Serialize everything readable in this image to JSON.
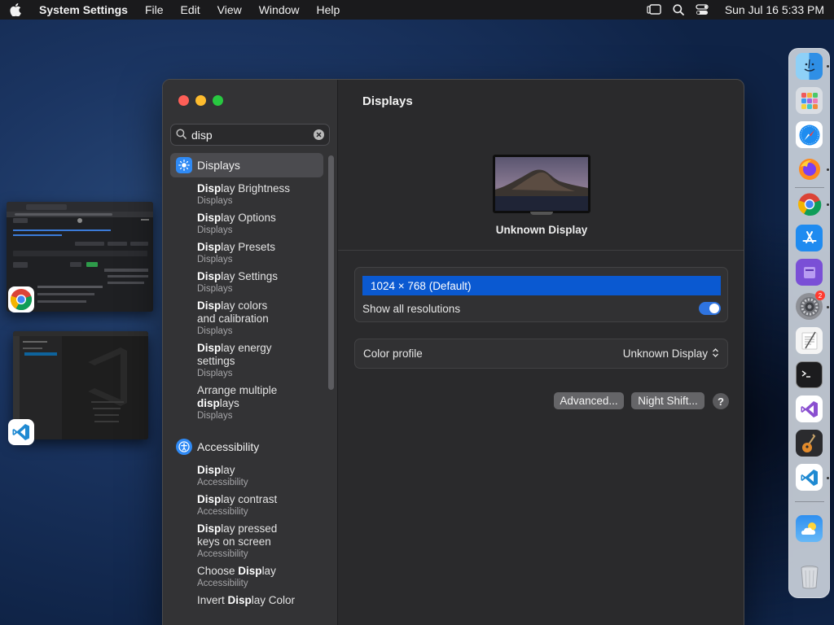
{
  "menubar": {
    "app_name": "System Settings",
    "menus": [
      "File",
      "Edit",
      "View",
      "Window",
      "Help"
    ],
    "clock": "Sun Jul 16  5:33 PM"
  },
  "sidebar": {
    "search": {
      "value": "disp",
      "placeholder": "Search"
    },
    "groups": [
      {
        "label": "Displays",
        "items": [
          {
            "match": "Disp",
            "rest": "lay Brightness",
            "sub": "Displays"
          },
          {
            "match": "Disp",
            "rest": "lay Options",
            "sub": "Displays"
          },
          {
            "match": "Disp",
            "rest": "lay Presets",
            "sub": "Displays"
          },
          {
            "match": "Disp",
            "rest": "lay Settings",
            "sub": "Displays"
          },
          {
            "match": "Disp",
            "rest": "lay colors and calibration",
            "sub": "Displays"
          },
          {
            "match": "Disp",
            "rest": "lay energy settings",
            "sub": "Displays"
          },
          {
            "pre": "Arrange multiple ",
            "match": "disp",
            "rest": "lays",
            "sub": "Displays"
          }
        ]
      },
      {
        "label": "Accessibility",
        "items": [
          {
            "match": "Disp",
            "rest": "lay",
            "sub": "Accessibility"
          },
          {
            "match": "Disp",
            "rest": "lay contrast",
            "sub": "Accessibility"
          },
          {
            "match": "Disp",
            "rest": "lay pressed keys on screen",
            "sub": "Accessibility"
          },
          {
            "pre": "Choose ",
            "match": "Disp",
            "rest": "lay",
            "sub": "Accessibility"
          },
          {
            "pre": "Invert ",
            "match": "Disp",
            "rest": "lay Color",
            "sub": ""
          }
        ]
      }
    ]
  },
  "main": {
    "title": "Displays",
    "display_name": "Unknown Display",
    "resolution_selected": "1024 × 768 (Default)",
    "show_all_label": "Show all resolutions",
    "show_all_on": true,
    "color_profile_label": "Color profile",
    "color_profile_value": "Unknown Display",
    "advanced_label": "Advanced...",
    "night_shift_label": "Night Shift...",
    "help_label": "?"
  },
  "dock": {
    "settings_badge": "2"
  }
}
